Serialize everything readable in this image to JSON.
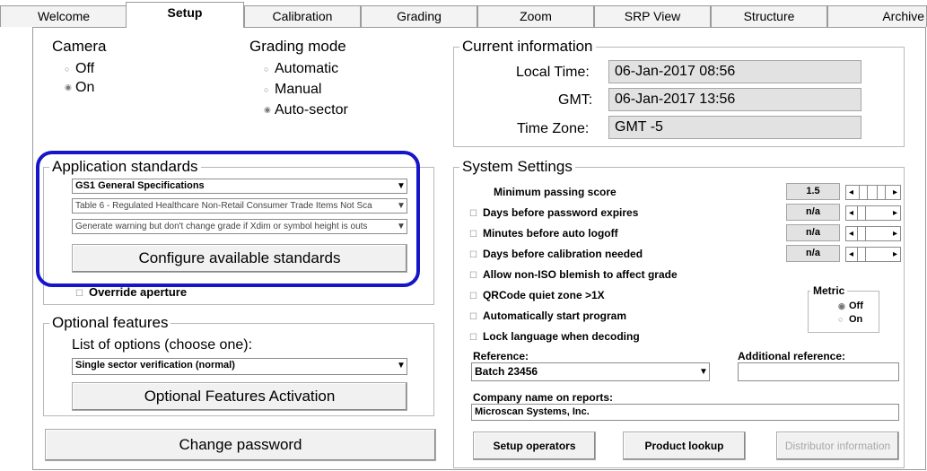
{
  "tabs": [
    "Welcome",
    "Setup",
    "Calibration",
    "Grading",
    "Zoom",
    "SRP View",
    "Structure",
    "Archive"
  ],
  "camera": {
    "title": "Camera",
    "options": [
      "Off",
      "On"
    ],
    "selected": "On"
  },
  "grading_mode": {
    "title": "Grading mode",
    "options": [
      "Automatic",
      "Manual",
      "Auto-sector"
    ],
    "selected": "Auto-sector"
  },
  "current_info": {
    "title": "Current information",
    "local_time_label": "Local Time:",
    "local_time": "06-Jan-2017 08:56",
    "gmt_label": "GMT:",
    "gmt": "06-Jan-2017 13:56",
    "tz_label": "Time Zone:",
    "tz": "GMT -5"
  },
  "app_standards": {
    "title": "Application standards",
    "dropdowns": [
      "GS1 General Specifications",
      "Table 6 - Regulated Healthcare Non-Retail Consumer Trade Items Not Sca",
      "Generate warning but don't change grade if Xdim or symbol height is outs"
    ],
    "configure_button": "Configure available standards",
    "override": "Override aperture"
  },
  "optional": {
    "title": "Optional features",
    "list_label": "List of options (choose one):",
    "selected": "Single sector verification (normal)",
    "activation_button": "Optional Features Activation"
  },
  "change_password": "Change password",
  "system": {
    "title": "System Settings",
    "min_score_label": "Minimum passing score",
    "min_score": "1.5",
    "pw_days": "Days before password expires",
    "pw_days_val": "n/a",
    "logoff": "Minutes before auto logoff",
    "logoff_val": "n/a",
    "calib": "Days before calibration needed",
    "calib_val": "n/a",
    "blemish": "Allow non-ISO blemish to affect grade",
    "qr": "QRCode quiet zone >1X",
    "autostart": "Automatically start program",
    "lock_lang": "Lock language when decoding",
    "metric_title": "Metric",
    "metric_options": [
      "Off",
      "On"
    ],
    "metric_selected": "Off",
    "reference_label": "Reference:",
    "reference": "Batch 23456",
    "add_ref_label": "Additional reference:",
    "add_ref": "",
    "company_label": "Company name on reports:",
    "company": "Microscan Systems, Inc.",
    "setup_operators": "Setup operators",
    "product_lookup": "Product lookup",
    "distributor": "Distributor information"
  },
  "colors": {
    "highlight": "#1616c8",
    "readonly_bg": "#e2e2e2"
  }
}
